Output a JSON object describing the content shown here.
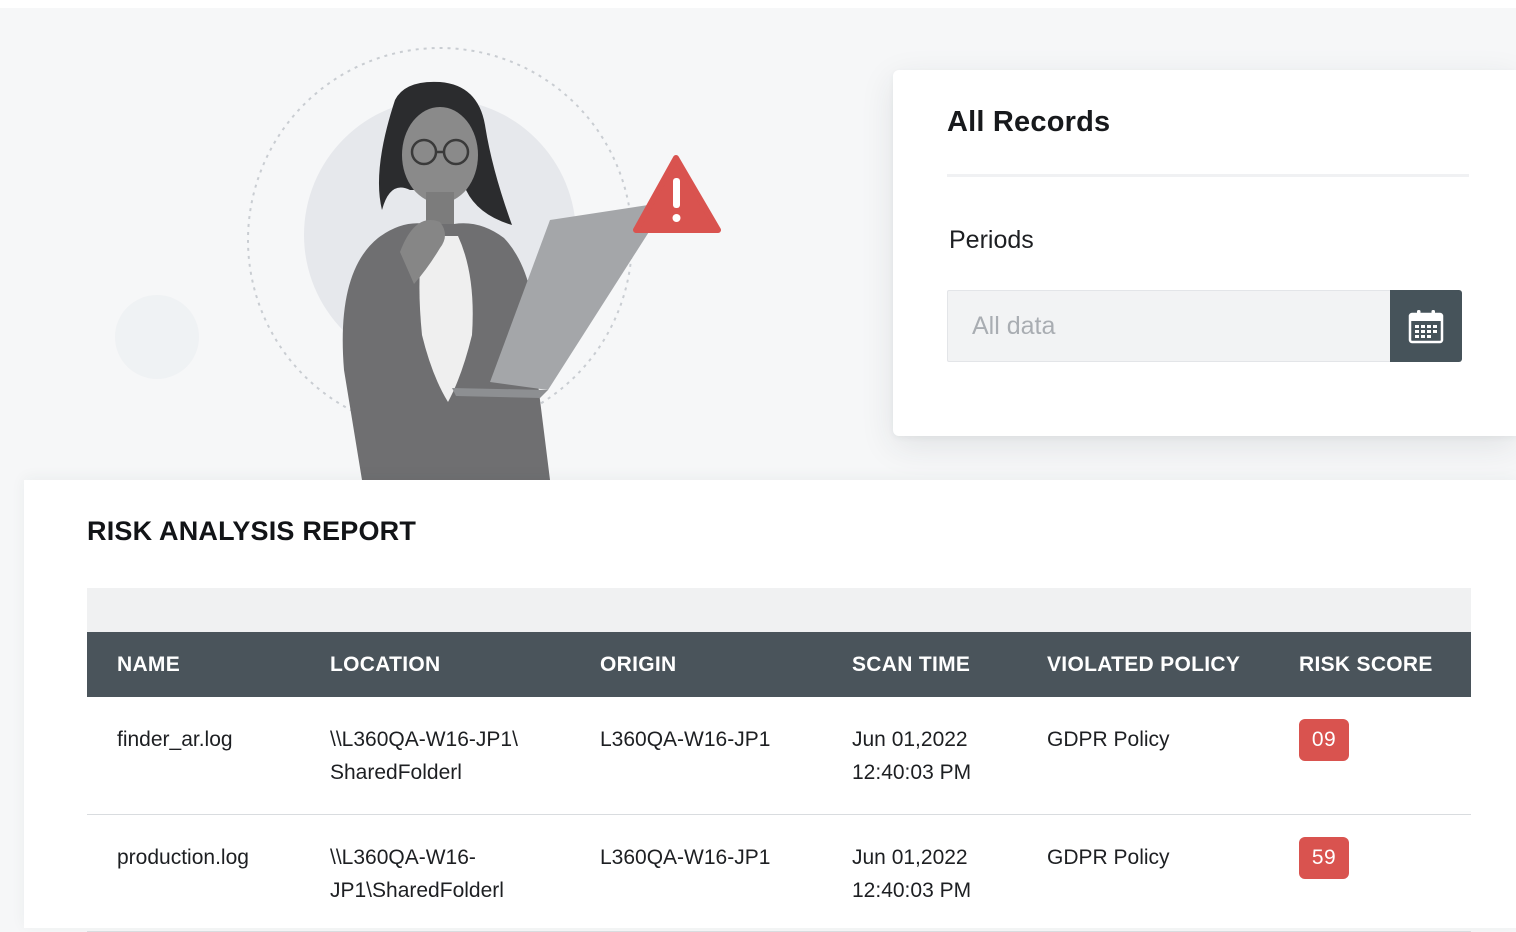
{
  "records": {
    "title": "All Records",
    "periods_label": "Periods",
    "period_input": {
      "value": "",
      "placeholder": "All data"
    },
    "calendar_icon": "calendar-icon"
  },
  "hero": {
    "alert_icon": "warning-triangle-icon"
  },
  "report": {
    "title": "RISK ANALYSIS REPORT",
    "columns": [
      "NAME",
      "LOCATION",
      "ORIGIN",
      "SCAN TIME",
      "VIOLATED POLICY",
      "RISK SCORE"
    ],
    "rows": [
      {
        "name": "finder_ar.log",
        "location": "\\\\L360QA-W16-JP1\\\nSharedFolderl",
        "origin": "L360QA-W16-JP1",
        "scan_time": "Jun 01,2022\n12:40:03 PM",
        "violated_policy": "GDPR Policy",
        "risk_score": "09"
      },
      {
        "name": "production.log",
        "location": "\\\\L360QA-W16-\nJP1\\SharedFolderl",
        "origin": "L360QA-W16-JP1",
        "scan_time": "Jun 01,2022\n12:40:03 PM",
        "violated_policy": "GDPR Policy",
        "risk_score": "59"
      }
    ]
  },
  "colors": {
    "header_bg": "#4a545b",
    "badge": "#d9534f",
    "calendar_btn": "#46535a",
    "alert": "#d9534f"
  }
}
